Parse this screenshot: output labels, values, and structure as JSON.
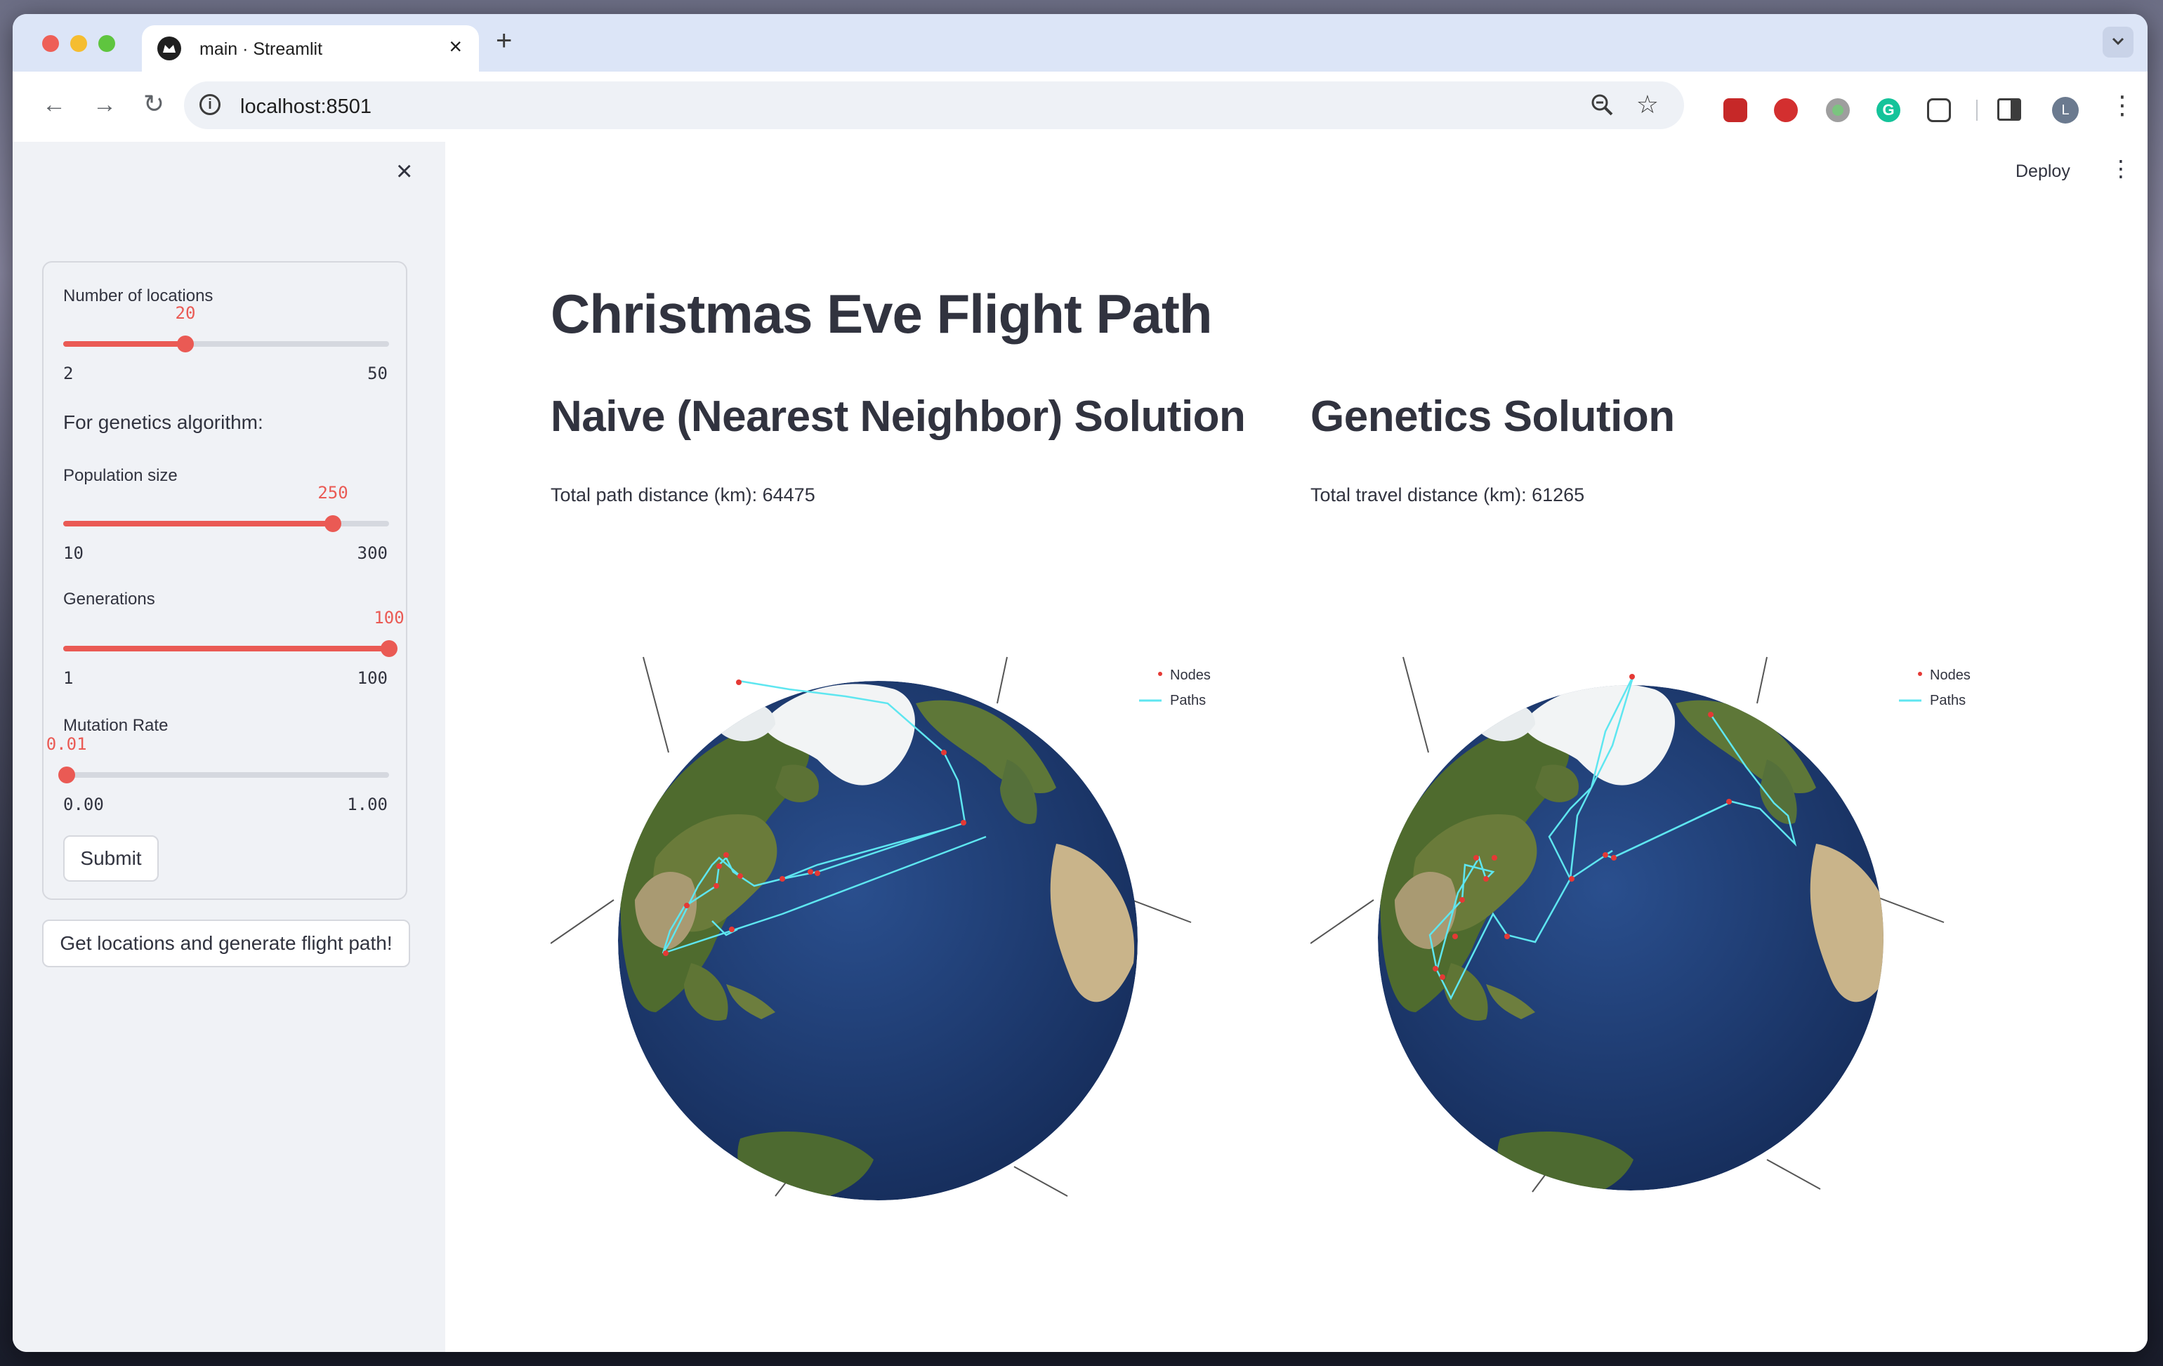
{
  "browser": {
    "tab_title": "main · Streamlit",
    "url": "localhost:8501",
    "profile_initial": "L",
    "extension_g_label": "G"
  },
  "header": {
    "deploy_label": "Deploy"
  },
  "sidebar": {
    "num_locations": {
      "label": "Number of locations",
      "value": "20",
      "min": "2",
      "max": "50",
      "fraction": 0.375
    },
    "genetics_heading": "For genetics algorithm:",
    "population_size": {
      "label": "Population size",
      "value": "250",
      "min": "10",
      "max": "300",
      "fraction": 0.8276
    },
    "generations": {
      "label": "Generations",
      "value": "100",
      "min": "1",
      "max": "100",
      "fraction": 1.0
    },
    "mutation_rate": {
      "label": "Mutation Rate",
      "value": "0.01",
      "min": "0.00",
      "max": "1.00",
      "fraction": 0.01
    },
    "submit_label": "Submit",
    "generate_label": "Get locations and generate flight path!"
  },
  "main": {
    "title": "Christmas Eve Flight Path",
    "naive": {
      "heading": "Naive (Nearest Neighbor) Solution",
      "distance_text": "Total path distance (km): 64475",
      "legend_nodes": "Nodes",
      "legend_paths": "Paths"
    },
    "genetics": {
      "heading": "Genetics Solution",
      "distance_text": "Total travel distance (km): 61265",
      "legend_nodes": "Nodes",
      "legend_paths": "Paths"
    }
  },
  "colors": {
    "accent": "#ea5a54",
    "node": "#e53935",
    "path": "#5ee6f0",
    "ocean": "#1e3b6e"
  }
}
